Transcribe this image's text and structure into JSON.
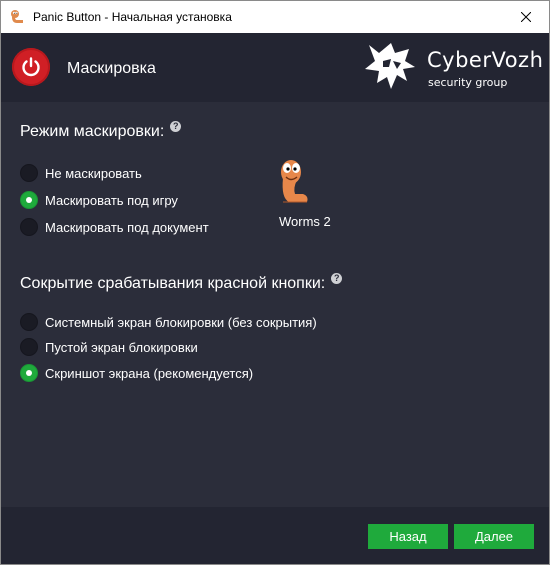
{
  "window": {
    "title": "Panic Button - Начальная установка"
  },
  "header": {
    "title": "Маскировка",
    "logo_name": "CyberVozh",
    "logo_sub": "security group"
  },
  "masking": {
    "title": "Режим маскировки:",
    "help": "?",
    "options": [
      {
        "label": "Не маскировать",
        "checked": false
      },
      {
        "label": "Маскировать под игру",
        "checked": true
      },
      {
        "label": "Маскировать под документ",
        "checked": false
      }
    ],
    "game_label": "Worms 2"
  },
  "hiding": {
    "title": "Сокрытие срабатывания красной кнопки:",
    "help": "?",
    "options": [
      {
        "label": "Системный экран блокировки (без сокрытия)",
        "checked": false
      },
      {
        "label": "Пустой экран блокировки",
        "checked": false
      },
      {
        "label": "Скриншот экрана (рекомендуется)",
        "checked": true
      }
    ]
  },
  "footer": {
    "back_label": "Назад",
    "next_label": "Далее"
  },
  "colors": {
    "accent_green": "#1faa3c",
    "power_red": "#d01f25",
    "background": "#2b2d3a",
    "header_bg": "#232532"
  }
}
